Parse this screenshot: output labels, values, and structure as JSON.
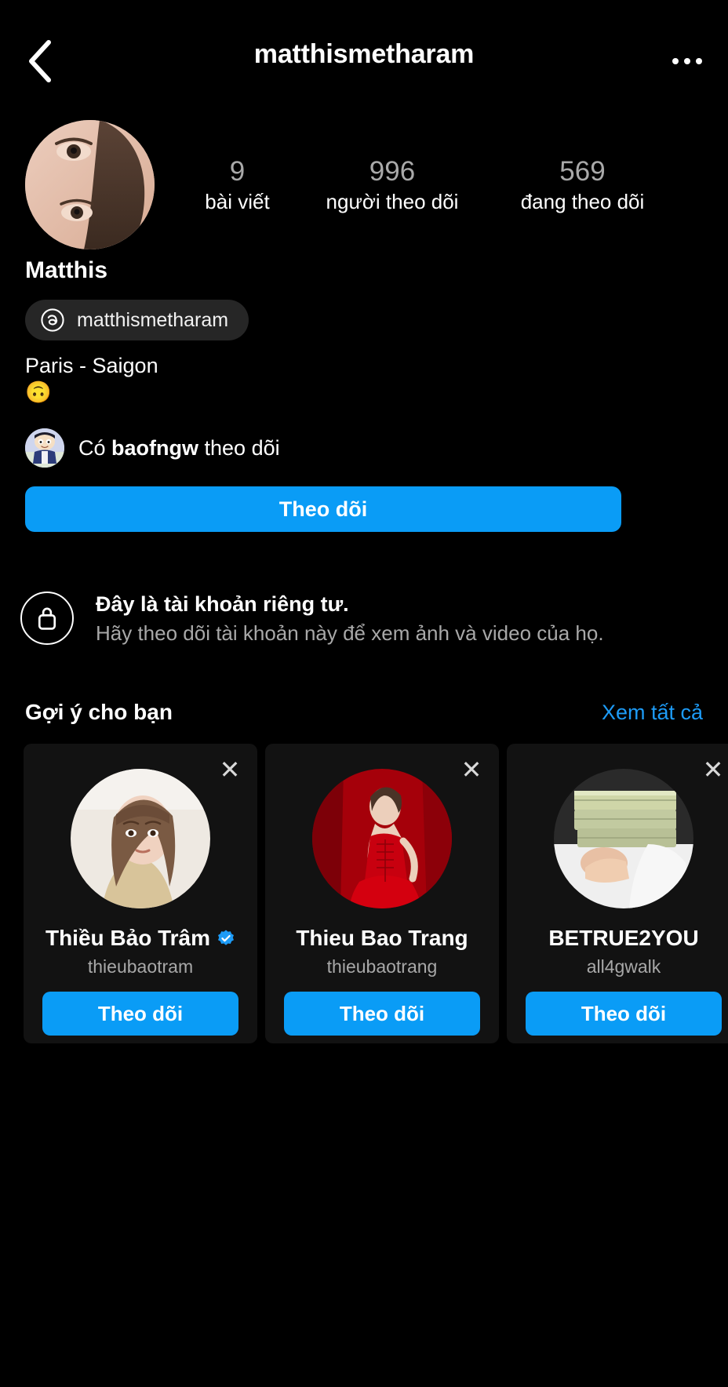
{
  "header": {
    "title": "matthismetharam",
    "back_icon": "chevron-left-icon",
    "menu_icon": "more-options-icon"
  },
  "profile": {
    "display_name": "Matthis",
    "threads_handle": "matthismetharam",
    "threads_icon": "threads-logo-icon",
    "bio_line_1": "Paris - Saigon",
    "bio_line_2": "🙃",
    "avatar_name": "profile-avatar",
    "stats": [
      {
        "value": "9",
        "label": "bài viết",
        "name": "posts"
      },
      {
        "value": "996",
        "label": "người theo dõi",
        "name": "followers"
      },
      {
        "value": "569",
        "label": "đang theo dõi",
        "name": "following"
      }
    ],
    "mutual": {
      "prefix": "Có ",
      "username": "baofngw",
      "suffix": " theo dõi"
    },
    "follow_label": "Theo dõi"
  },
  "private": {
    "title": "Đây là tài khoản riêng tư.",
    "subtitle": "Hãy theo dõi tài khoản này để xem ảnh và video của họ.",
    "lock_icon": "lock-icon"
  },
  "suggestions": {
    "title": "Gợi ý cho bạn",
    "see_all": "Xem tất cả",
    "close_label": "✕",
    "cards": [
      {
        "name": "Thiều Bảo Trâm",
        "username": "thieubaotram",
        "verified": true,
        "follow_label": "Theo dõi"
      },
      {
        "name": "Thieu Bao Trang",
        "username": "thieubaotrang",
        "verified": false,
        "follow_label": "Theo dõi"
      },
      {
        "name": "BETRUE2YOU",
        "username": "all4gwalk",
        "verified": false,
        "follow_label": "Theo dõi"
      }
    ]
  },
  "colors": {
    "accent_blue": "#0a9cf6",
    "link_blue": "#1d9bf6",
    "background": "#000000",
    "card_bg": "#121212",
    "pill_bg": "#262626",
    "muted_text": "#a8a8a8"
  }
}
